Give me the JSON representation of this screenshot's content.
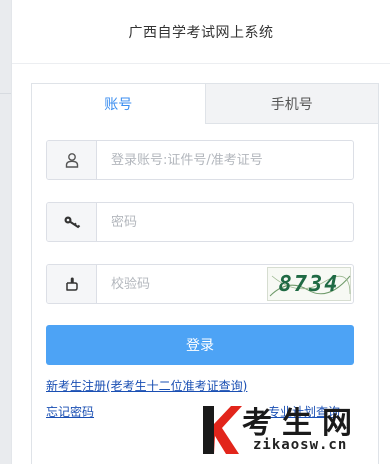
{
  "header": {
    "title": "广西自学考试网上系统"
  },
  "tabs": [
    {
      "label": "账号",
      "active": true
    },
    {
      "label": "手机号",
      "active": false
    }
  ],
  "form": {
    "account": {
      "placeholder": "登录账号:证件号/准考证号",
      "icon": "user-icon"
    },
    "password": {
      "placeholder": "密码",
      "icon": "key-icon"
    },
    "captcha": {
      "placeholder": "校验码",
      "icon": "hand-pointer-icon",
      "code": "8734"
    }
  },
  "actions": {
    "login_label": "登录"
  },
  "links": {
    "register": "新考生注册(老考生十二位准考证查询)",
    "forgot": "忘记密码",
    "query": "专业计划查询"
  },
  "watermark": {
    "glyph": "K",
    "name": "考生网",
    "domain": "zikaosw.cn"
  },
  "colors": {
    "accent": "#3b8ef0",
    "button": "#4da3f5",
    "link": "#1a4fb3",
    "watermark_red": "#e2251b"
  }
}
